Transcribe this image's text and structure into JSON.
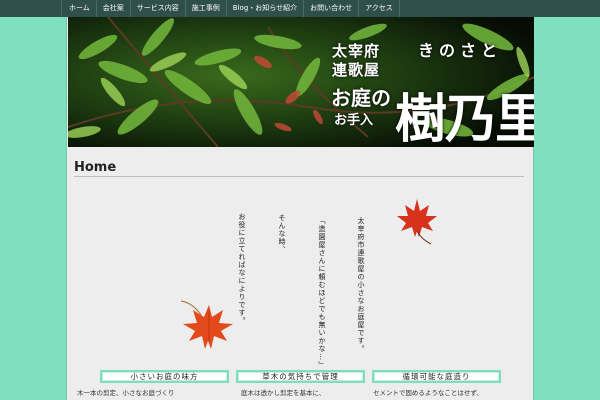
{
  "nav": {
    "items": [
      {
        "label": "ホーム"
      },
      {
        "label": "会社案"
      },
      {
        "label": "サービス内容"
      },
      {
        "label": "施工事例"
      },
      {
        "label": "Blog・お知らせ紹介"
      },
      {
        "label": "お問い合わせ"
      },
      {
        "label": "アクセス"
      }
    ]
  },
  "banner": {
    "line1": "太宰府",
    "line2": "連歌屋",
    "line3": "きのさと",
    "line4": "お庭の",
    "line5": "お手入",
    "logo": "樹乃里"
  },
  "main": {
    "title": "Home",
    "vertical_lines": [
      "太宰府市連歌屋の小さなお庭屋です。",
      "「造園屋さんに頼むほどでも無いかな…」",
      "そんな時、",
      "お役に立てればなによりです。"
    ]
  },
  "sections": [
    {
      "label": "小さいお庭の味方",
      "text": "木一本の剪定、小さなお庭づくり"
    },
    {
      "label": "草木の気持ちで管理",
      "text": "庭木は透かし剪定を基本に、"
    },
    {
      "label": "循環可能な庭造り",
      "text": "セメントで固めるようなことはせず、"
    }
  ],
  "colors": {
    "background": "#7fe0c0",
    "nav": "#2f4f4c",
    "panel": "#ededed",
    "button_border": "#7fdcc0",
    "leaf_red": "#d8321c"
  }
}
